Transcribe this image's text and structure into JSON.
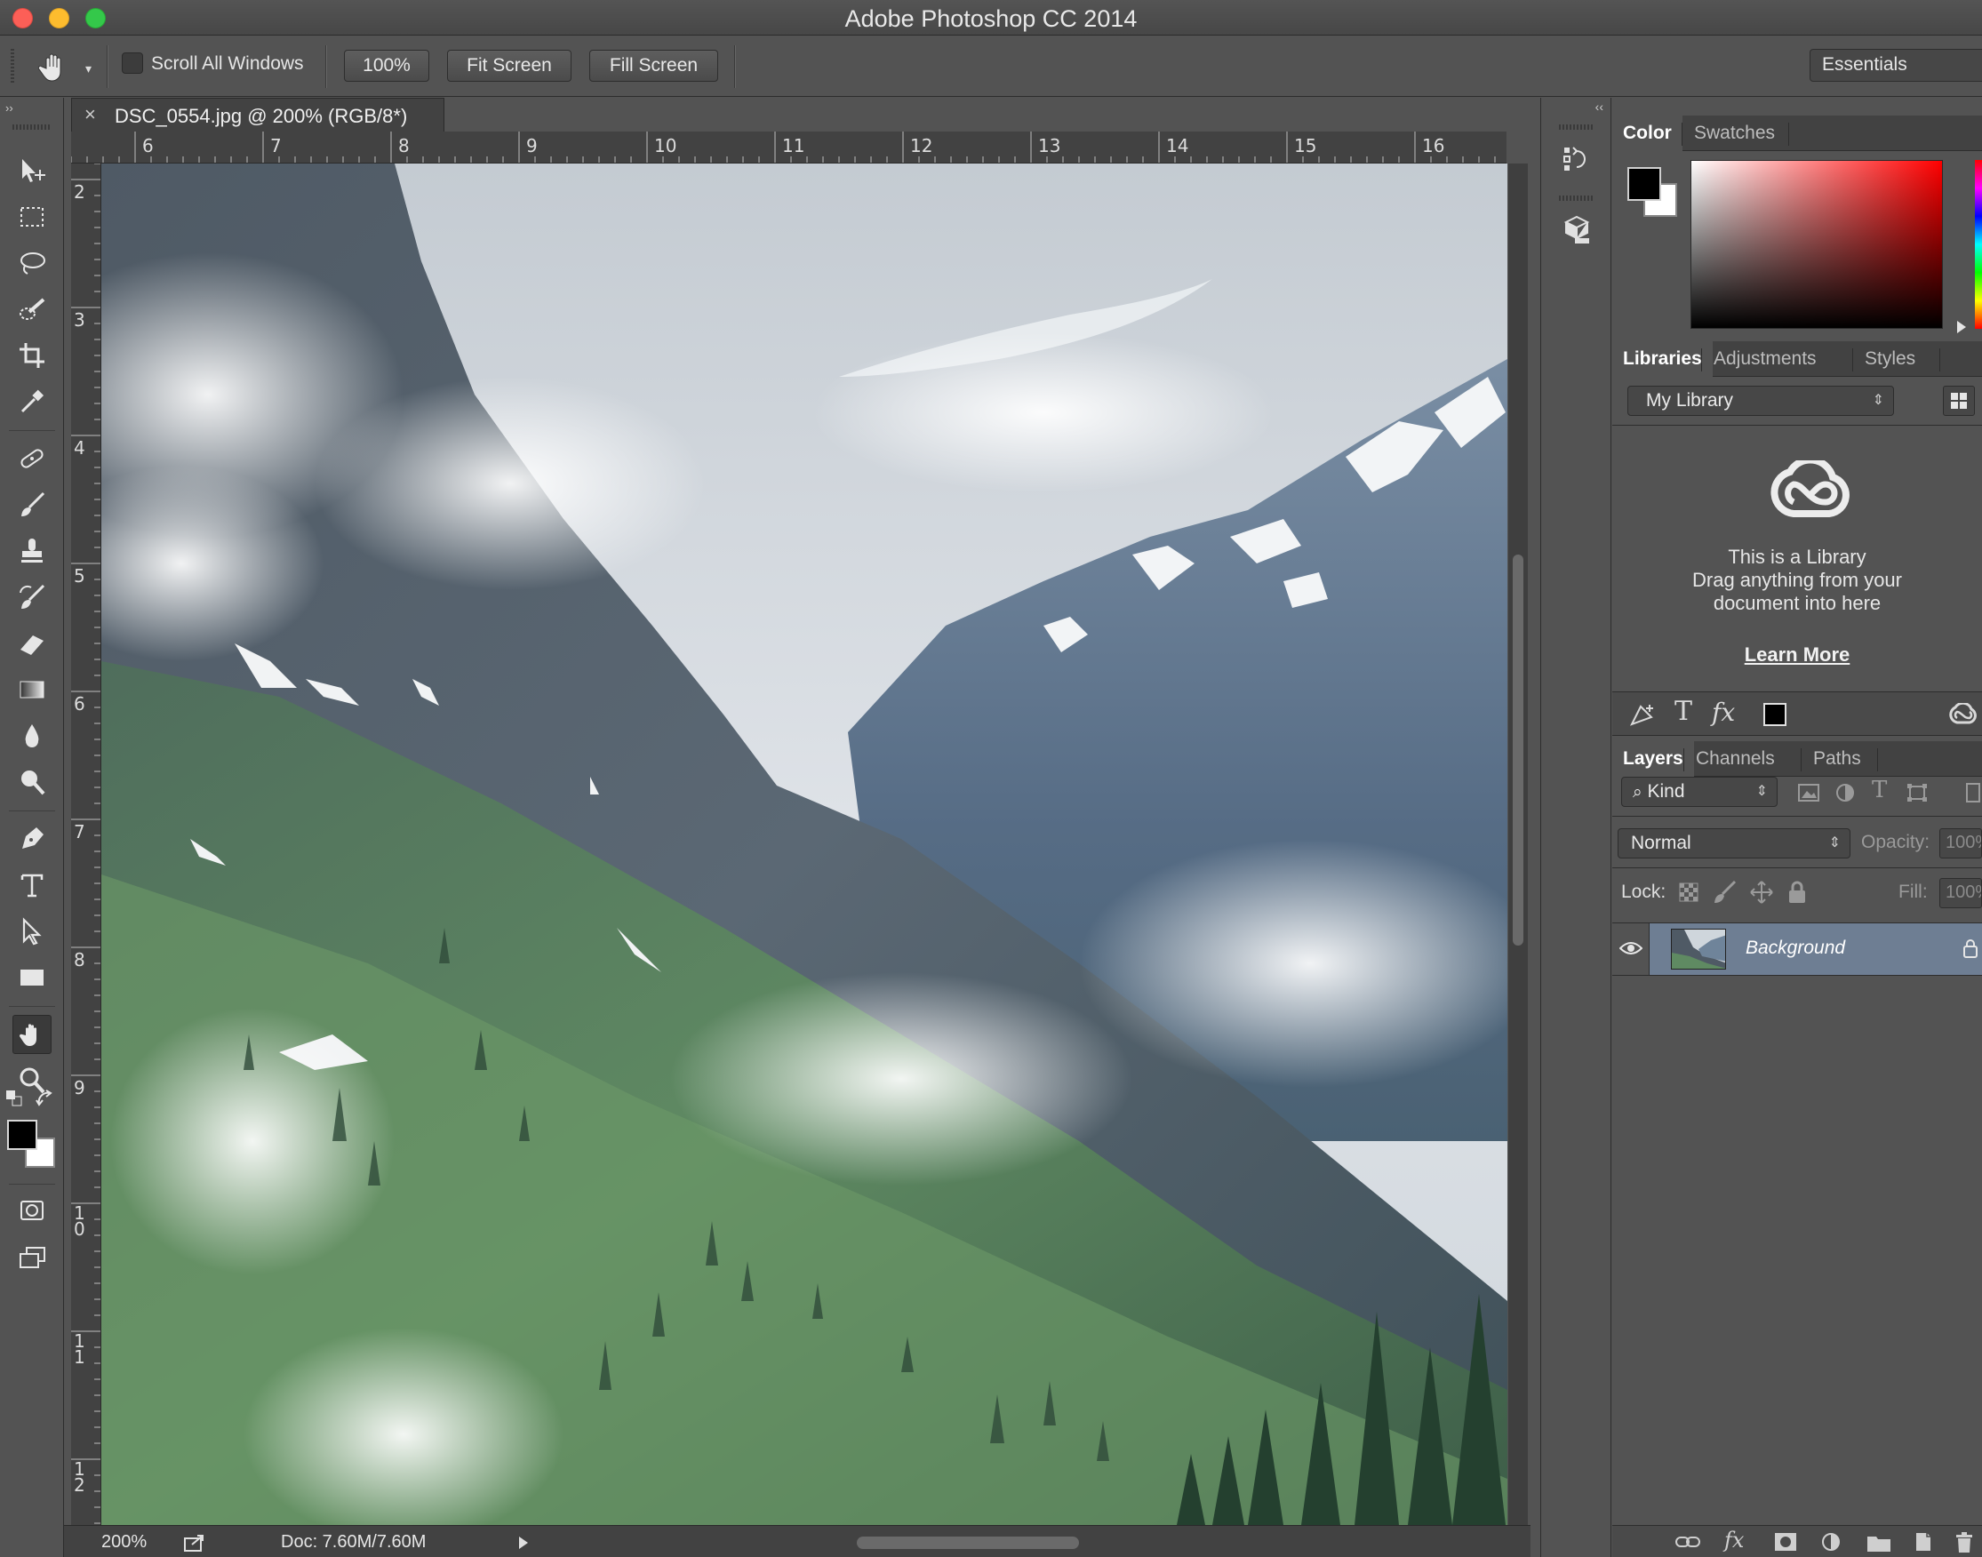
{
  "window": {
    "title": "Adobe Photoshop CC 2014"
  },
  "options_bar": {
    "scroll_all_windows_label": "Scroll All Windows",
    "zoom_100_label": "100%",
    "fit_screen_label": "Fit Screen",
    "fill_screen_label": "Fill Screen",
    "workspace": "Essentials"
  },
  "document": {
    "tab_label": "DSC_0554.jpg @ 200% (RGB/8*)",
    "ruler_top": [
      "6",
      "7",
      "8",
      "9",
      "10",
      "11",
      "12",
      "13",
      "14",
      "15",
      "16"
    ],
    "ruler_left": [
      "2",
      "3",
      "4",
      "5",
      "6",
      "7",
      "8",
      "9",
      "10",
      "11",
      "12"
    ],
    "zoom": "200%",
    "doc_size": "Doc: 7.60M/7.60M"
  },
  "colors": {
    "foreground": "#000000",
    "background": "#ffffff"
  },
  "color_panel": {
    "tabs": [
      "Color",
      "Swatches"
    ]
  },
  "libraries_panel": {
    "tabs": [
      "Libraries",
      "Adjustments",
      "Styles"
    ],
    "library_select": "My Library",
    "message_line1": "This is a Library",
    "message_line2": "Drag anything from your",
    "message_line3": "document into here",
    "learn_more": "Learn More"
  },
  "layers_panel": {
    "tabs": [
      "Layers",
      "Channels",
      "Paths"
    ],
    "filter_kind": "Kind",
    "blend_mode": "Normal",
    "opacity_label": "Opacity:",
    "opacity_value": "100%",
    "lock_label": "Lock:",
    "fill_label": "Fill:",
    "fill_value": "100%",
    "layers": [
      {
        "name": "Background",
        "visible": true,
        "locked": true
      }
    ]
  }
}
